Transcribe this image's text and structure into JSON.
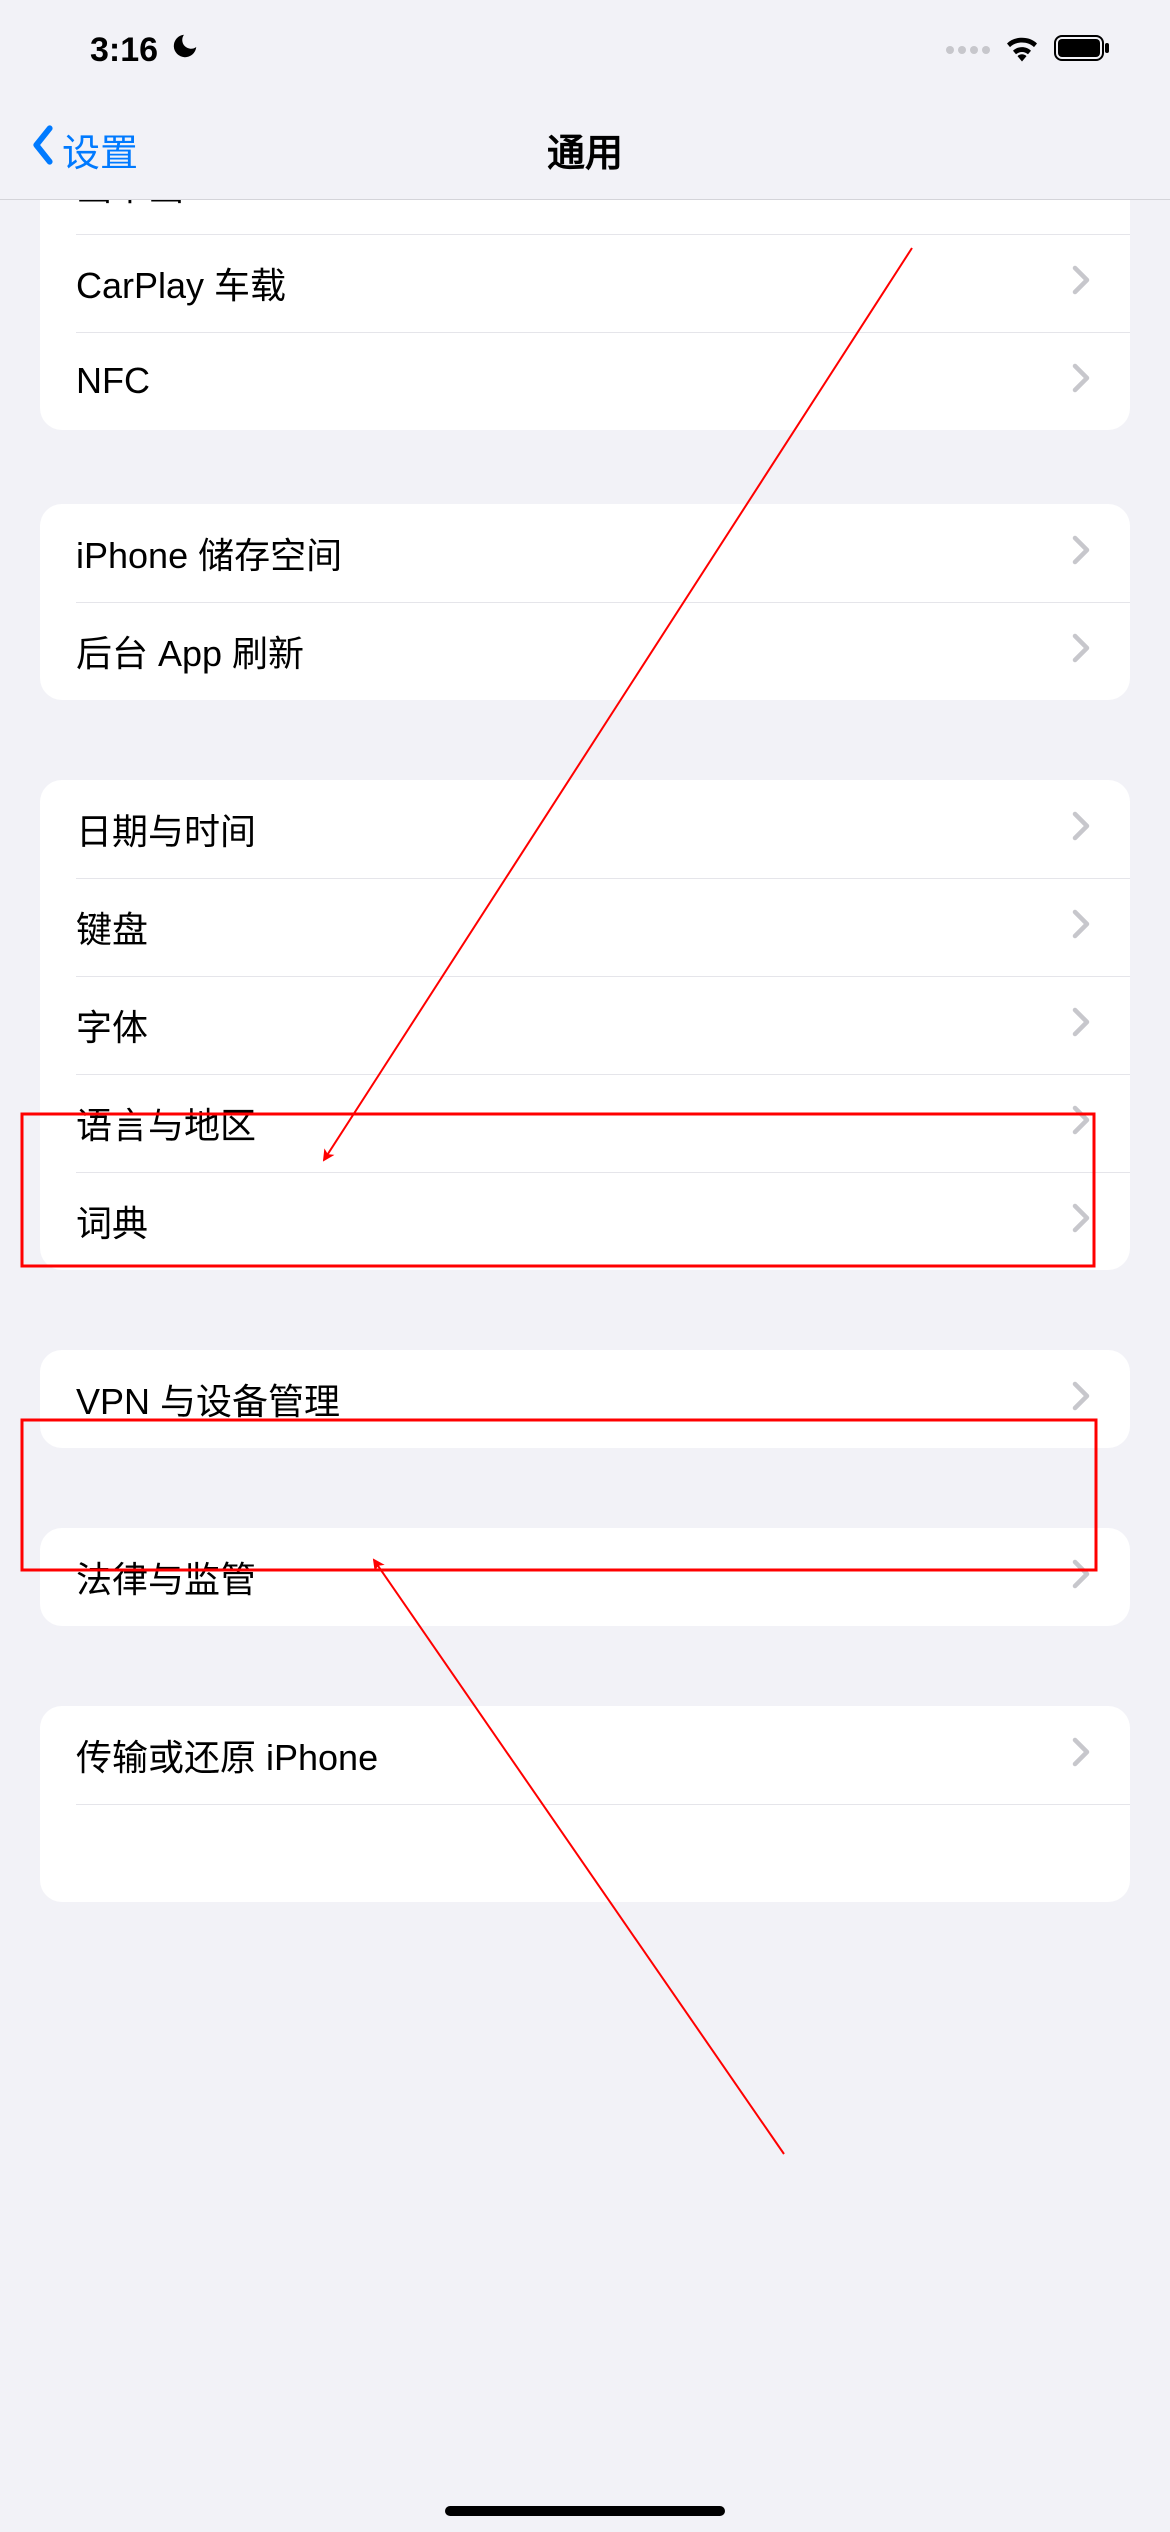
{
  "status": {
    "time": "3:16"
  },
  "nav": {
    "back": "设置",
    "title": "通用"
  },
  "groups": [
    {
      "id": "g1",
      "rows": [
        {
          "id": "pip",
          "label": "画中画"
        },
        {
          "id": "carplay",
          "label": "CarPlay 车载"
        },
        {
          "id": "nfc",
          "label": "NFC"
        }
      ]
    },
    {
      "id": "g2",
      "rows": [
        {
          "id": "storage",
          "label": "iPhone 储存空间"
        },
        {
          "id": "refresh",
          "label": "后台 App 刷新"
        }
      ]
    },
    {
      "id": "g3",
      "rows": [
        {
          "id": "datetime",
          "label": "日期与时间"
        },
        {
          "id": "keyboard",
          "label": "键盘"
        },
        {
          "id": "fonts",
          "label": "字体"
        },
        {
          "id": "lang",
          "label": "语言与地区"
        },
        {
          "id": "dict",
          "label": "词典"
        }
      ]
    },
    {
      "id": "g4",
      "rows": [
        {
          "id": "vpn",
          "label": "VPN 与设备管理"
        }
      ]
    },
    {
      "id": "g5",
      "rows": [
        {
          "id": "legal",
          "label": "法律与监管"
        }
      ]
    },
    {
      "id": "g6",
      "rows": [
        {
          "id": "transfer",
          "label": "传输或还原 iPhone"
        }
      ]
    }
  ],
  "annotations": {
    "box_datetime": true,
    "box_lang": true,
    "arrow_to_datetime": true,
    "arrow_to_lang": true
  }
}
